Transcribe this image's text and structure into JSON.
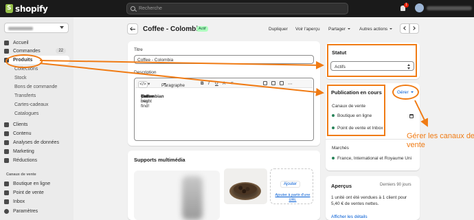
{
  "brand": {
    "logo_text": "shopify"
  },
  "topbar": {
    "search_placeholder": "Recherche",
    "notification_count": "1"
  },
  "sidebar": {
    "nav": [
      {
        "label": "Accueil"
      },
      {
        "label": "Commandes",
        "count": "22"
      },
      {
        "label": "Produits"
      },
      {
        "label": "Collections"
      },
      {
        "label": "Stock"
      },
      {
        "label": "Bons de commande"
      },
      {
        "label": "Transferts"
      },
      {
        "label": "Cartes-cadeaux"
      },
      {
        "label": "Catalogues"
      },
      {
        "label": "Clients"
      },
      {
        "label": "Contenu"
      },
      {
        "label": "Analyses de données"
      },
      {
        "label": "Marketing"
      },
      {
        "label": "Réductions"
      }
    ],
    "channels_heading": "Canaux de vente",
    "channels": [
      {
        "label": "Boutique en ligne"
      },
      {
        "label": "Point de vente"
      },
      {
        "label": "Inbox"
      }
    ],
    "settings_label": "Paramètres"
  },
  "header": {
    "title": "Coffee - Colombia",
    "status_badge": "Actif",
    "actions": {
      "duplicate": "Dupliquer",
      "preview": "Voir l'aperçu",
      "share": "Partager",
      "more": "Autres actions"
    }
  },
  "product": {
    "title_label": "Titre",
    "title_value": "Coffee - Colombia",
    "description_label": "Description",
    "toolbar": {
      "format": "Paragraphe",
      "code": "</>"
    },
    "description": {
      "before": "The best ",
      "highlight1": "Colombian",
      "middle": " ",
      "highlight2": "coffee",
      "after": " you might find!"
    }
  },
  "status_card": {
    "title": "Statut",
    "value": "Actifs"
  },
  "publication": {
    "title": "Publication en cours",
    "manage": "Gérer",
    "channels_label": "Canaux de vente",
    "channels": [
      "Boutique en ligne",
      "Point de vente et Inbox"
    ],
    "markets_label": "Marchés",
    "markets": "France, International et Royaume Uni"
  },
  "media": {
    "title": "Supports multimédia",
    "add": "Ajouter",
    "add_url": "Ajouter à partir d'une URL"
  },
  "insights": {
    "title": "Aperçus",
    "period": "Derniers 90 jours",
    "text": "1 unité ont été vendues à 1 client pour 5,40 € de ventes nettes.",
    "link": "Afficher les détails"
  },
  "annotation": {
    "text": "Gérer les canaux de vente",
    "color": "#f07b14"
  },
  "colors": {
    "accent": "#f07b14",
    "link": "#005bd3",
    "active_badge": "#affebf",
    "topbar": "#1a1a1a"
  }
}
